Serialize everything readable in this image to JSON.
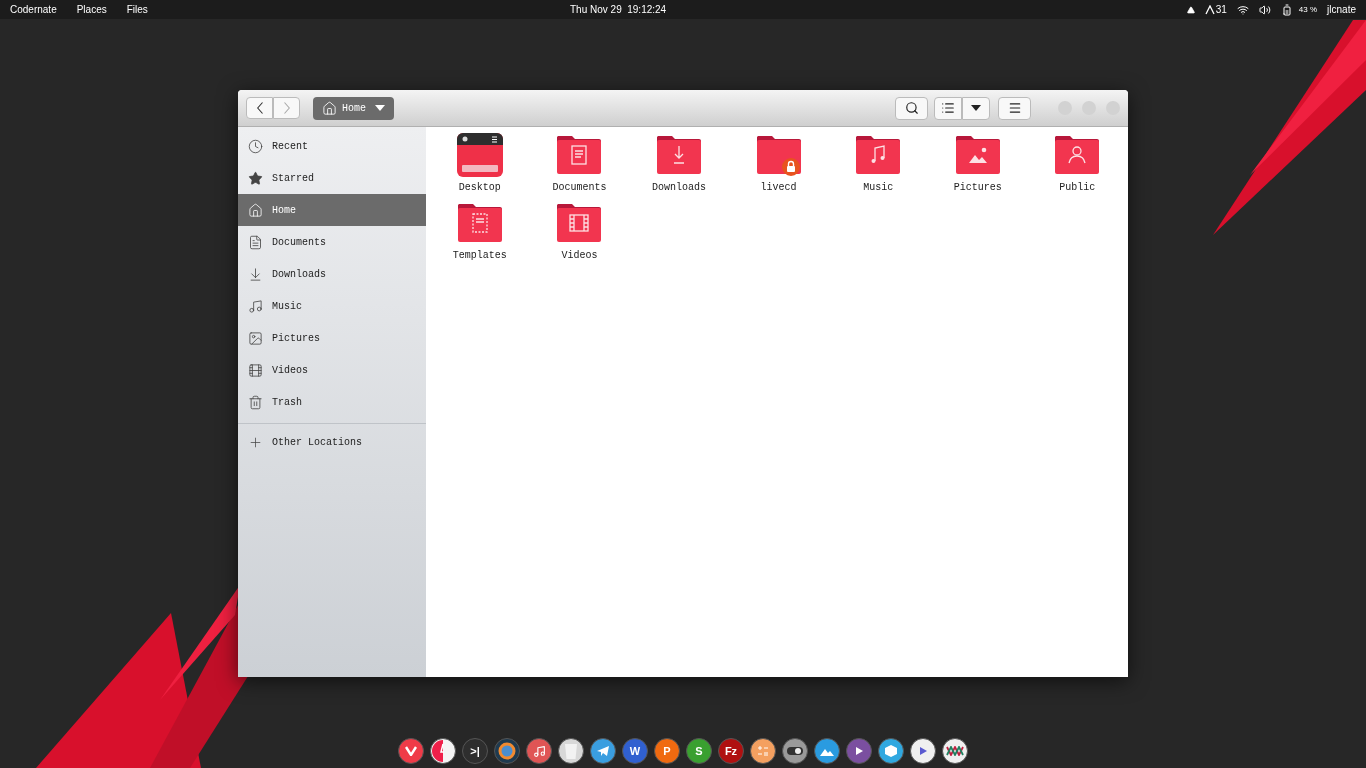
{
  "top_bar": {
    "menus": [
      "Codernate",
      "Places",
      "Files"
    ],
    "clock": "Thu Nov 29  19:12:24",
    "workspace": "31",
    "battery_reading": "43 %",
    "user": "jlcnate"
  },
  "window": {
    "path_button": {
      "label": "Home"
    },
    "sidebar": {
      "places": [
        {
          "label": "Recent",
          "kind": "recent",
          "selected": false
        },
        {
          "label": "Starred",
          "kind": "starred",
          "selected": false
        },
        {
          "label": "Home",
          "kind": "home",
          "selected": true
        },
        {
          "label": "Documents",
          "kind": "documents",
          "selected": false
        },
        {
          "label": "Downloads",
          "kind": "downloads",
          "selected": false
        },
        {
          "label": "Music",
          "kind": "music",
          "selected": false
        },
        {
          "label": "Pictures",
          "kind": "pictures",
          "selected": false
        },
        {
          "label": "Videos",
          "kind": "videos",
          "selected": false
        },
        {
          "label": "Trash",
          "kind": "trash",
          "selected": false
        }
      ],
      "other": {
        "label": "Other Locations"
      }
    },
    "files": [
      {
        "name": "Desktop",
        "kind": "desktop"
      },
      {
        "name": "Documents",
        "kind": "documents"
      },
      {
        "name": "Downloads",
        "kind": "downloads"
      },
      {
        "name": "livecd",
        "kind": "locked"
      },
      {
        "name": "Music",
        "kind": "music"
      },
      {
        "name": "Pictures",
        "kind": "pictures"
      },
      {
        "name": "Public",
        "kind": "public"
      },
      {
        "name": "Templates",
        "kind": "templates"
      },
      {
        "name": "Videos",
        "kind": "videos"
      }
    ]
  },
  "dock": [
    {
      "kind": "vee",
      "color": "#ef3b48"
    },
    {
      "kind": "half",
      "color": "#f5f5f5"
    },
    {
      "kind": "glyph",
      "color": "#2e2e2e",
      "glyph": ">|"
    },
    {
      "kind": "ring",
      "color": "#1f3a4f"
    },
    {
      "kind": "note",
      "color": "#e05555"
    },
    {
      "kind": "bin",
      "color": "#d8d8d8"
    },
    {
      "kind": "plane",
      "color": "#3a9ee0"
    },
    {
      "kind": "glyph",
      "color": "#3060d0",
      "glyph": "W"
    },
    {
      "kind": "glyph",
      "color": "#f06a10",
      "glyph": "P"
    },
    {
      "kind": "glyph",
      "color": "#3aa030",
      "glyph": "S"
    },
    {
      "kind": "glyph",
      "color": "#b01010",
      "glyph": "Fz"
    },
    {
      "kind": "calc",
      "color": "#f4a060"
    },
    {
      "kind": "toggle",
      "color": "#9a9a9a"
    },
    {
      "kind": "mountain",
      "color": "#2a9be0"
    },
    {
      "kind": "play",
      "color": "#7b4fa0"
    },
    {
      "kind": "cube",
      "color": "#30a8e0"
    },
    {
      "kind": "play",
      "color": "#f0f0f0"
    },
    {
      "kind": "weave",
      "color": "#f0f0f0"
    }
  ]
}
